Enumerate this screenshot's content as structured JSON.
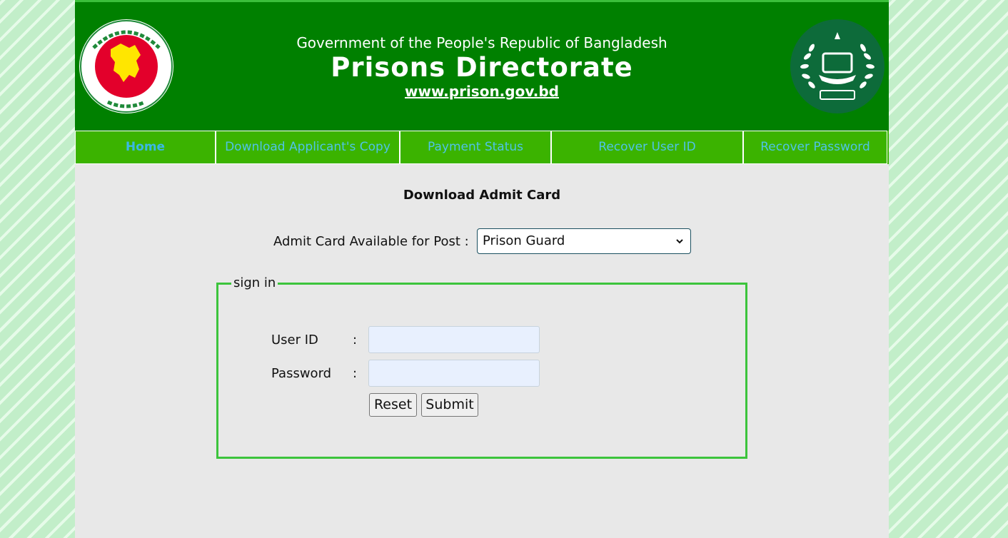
{
  "header": {
    "subtitle": "Government of the People's Republic of Bangladesh",
    "title": "Prisons Directorate",
    "url": "www.prison.gov.bd",
    "left_logo": "government-seal-icon",
    "right_logo": "prisons-emblem-icon"
  },
  "nav": {
    "items": [
      {
        "label": "Home"
      },
      {
        "label": "Download Applicant's Copy"
      },
      {
        "label": "Payment Status"
      },
      {
        "label": "Recover User ID"
      },
      {
        "label": "Recover Password"
      }
    ]
  },
  "main": {
    "title": "Download Admit Card",
    "post_label": "Admit Card Available for Post :",
    "post_selected": "Prison Guard"
  },
  "signin": {
    "legend": "sign in",
    "user_id_label": "User ID",
    "password_label": "Password",
    "colon": ":",
    "reset_label": "Reset",
    "submit_label": "Submit"
  },
  "colors": {
    "header_green": "#008000",
    "nav_green": "#3bb300",
    "nav_text": "#4fc3e8",
    "fieldset_border": "#3cc43c"
  }
}
